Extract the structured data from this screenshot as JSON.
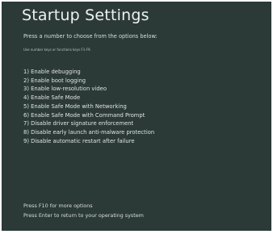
{
  "screen": {
    "title": "Startup Settings",
    "subtitle": "Press a number to choose from the options below:",
    "hint": "Use number keys or functions keys F1-F9."
  },
  "options": [
    {
      "label": "1) Enable debugging"
    },
    {
      "label": "2) Enable boot logging"
    },
    {
      "label": "3) Enable low-resolution video"
    },
    {
      "label": "4) Enable Safe Mode"
    },
    {
      "label": "5) Enable Safe Mode with Networking"
    },
    {
      "label": "6) Enable Safe Mode with Command Prompt"
    },
    {
      "label": "7) Disable driver signature enforcement"
    },
    {
      "label": "8) Disable early launch anti-malware protection"
    },
    {
      "label": "9) Disable automatic restart after failure"
    }
  ],
  "footer": {
    "more_options": "Press F10 for more options",
    "return": "Press Enter to return to your operating system"
  },
  "colors": {
    "background": "#2c3a37",
    "text": "#dfe5e2"
  }
}
